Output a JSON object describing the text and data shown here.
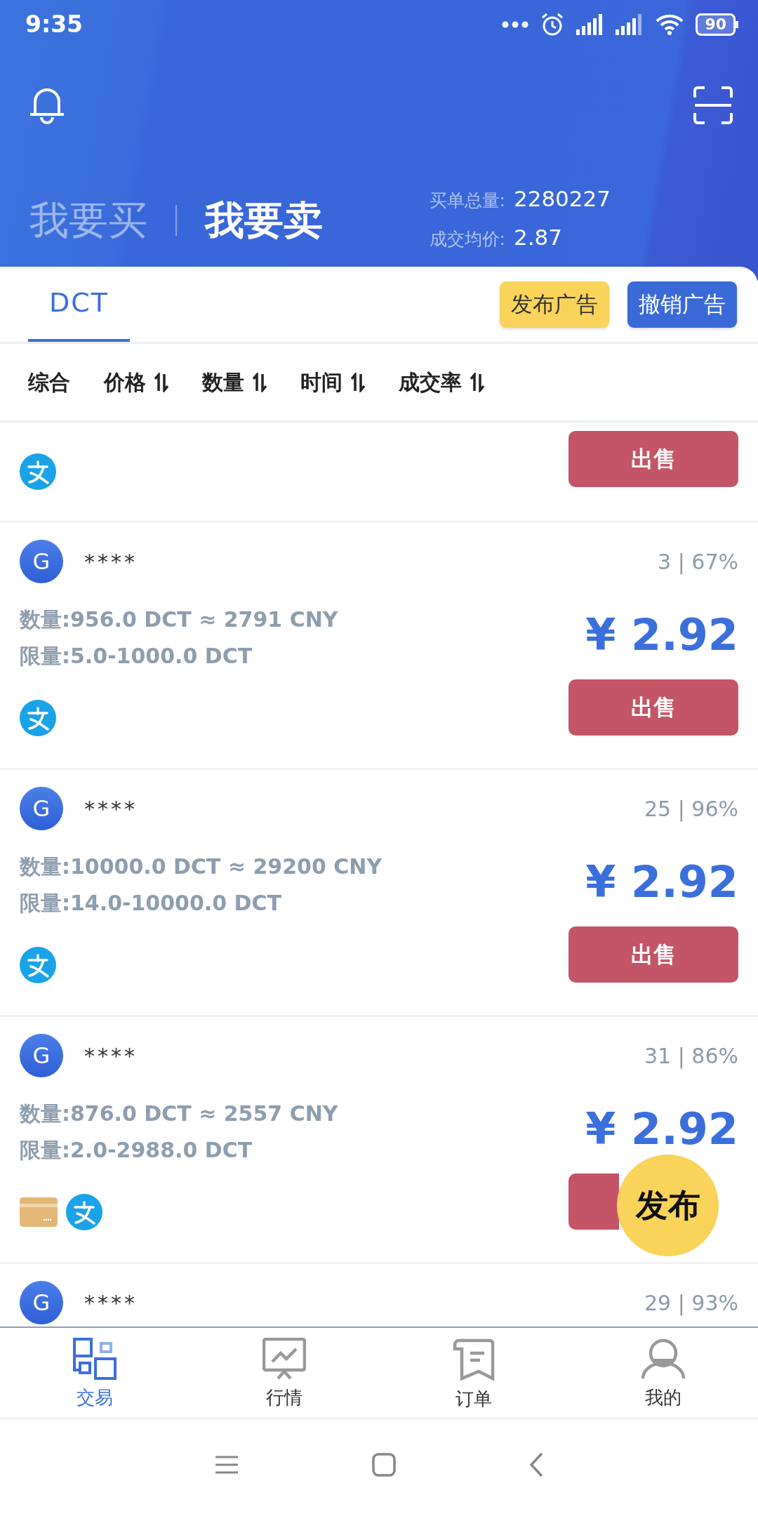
{
  "status_bar": {
    "time": "9:35",
    "battery": "90"
  },
  "header": {
    "tabs": [
      {
        "label": "我要买",
        "selected": false
      },
      {
        "label": "我要卖",
        "selected": true
      }
    ],
    "stats": [
      {
        "label": "买单总量:",
        "value": "2280227"
      },
      {
        "label": "成交均价:",
        "value": "2.87"
      }
    ]
  },
  "coin_tabs": [
    {
      "label": "DCT",
      "selected": true
    }
  ],
  "actions": [
    {
      "label": "发布广告",
      "kind": "publish"
    },
    {
      "label": "撤销广告",
      "kind": "revoke"
    }
  ],
  "filters": [
    {
      "label": "综合",
      "sortable": false
    },
    {
      "label": "价格",
      "sortable": true
    },
    {
      "label": "数量",
      "sortable": true
    },
    {
      "label": "时间",
      "sortable": true
    },
    {
      "label": "成交率",
      "sortable": true
    }
  ],
  "listings": [
    {
      "payments": [
        {
          "kind": "alipay"
        }
      ],
      "button": "出售"
    },
    {
      "avatar": "G",
      "name": "****",
      "stats": "3 | 67%",
      "amount": "数量:956.0 DCT ≈ 2791 CNY",
      "limit": "限量:5.0-1000.0 DCT",
      "price": "¥ 2.92",
      "payments": [
        {
          "kind": "alipay"
        }
      ],
      "button": "出售"
    },
    {
      "avatar": "G",
      "name": "****",
      "stats": "25 | 96%",
      "amount": "数量:10000.0 DCT ≈ 29200 CNY",
      "limit": "限量:14.0-10000.0 DCT",
      "price": "¥ 2.92",
      "payments": [
        {
          "kind": "alipay"
        }
      ],
      "button": "出售"
    },
    {
      "avatar": "G",
      "name": "****",
      "stats": "31 | 86%",
      "amount": "数量:876.0 DCT ≈ 2557 CNY",
      "limit": "限量:2.0-2988.0 DCT",
      "price": "¥ 2.92",
      "payments": [
        {
          "kind": "card"
        },
        {
          "kind": "alipay"
        }
      ],
      "has_button": true
    },
    {
      "avatar": "G",
      "name": "****",
      "stats": "29 | 93%"
    }
  ],
  "fab": {
    "label": "发布"
  },
  "bottom_nav": [
    {
      "label": "交易",
      "kind": "trade",
      "selected": true
    },
    {
      "label": "行情",
      "kind": "market",
      "selected": false
    },
    {
      "label": "订单",
      "kind": "orders",
      "selected": false
    },
    {
      "label": "我的",
      "kind": "profile",
      "selected": false
    }
  ]
}
